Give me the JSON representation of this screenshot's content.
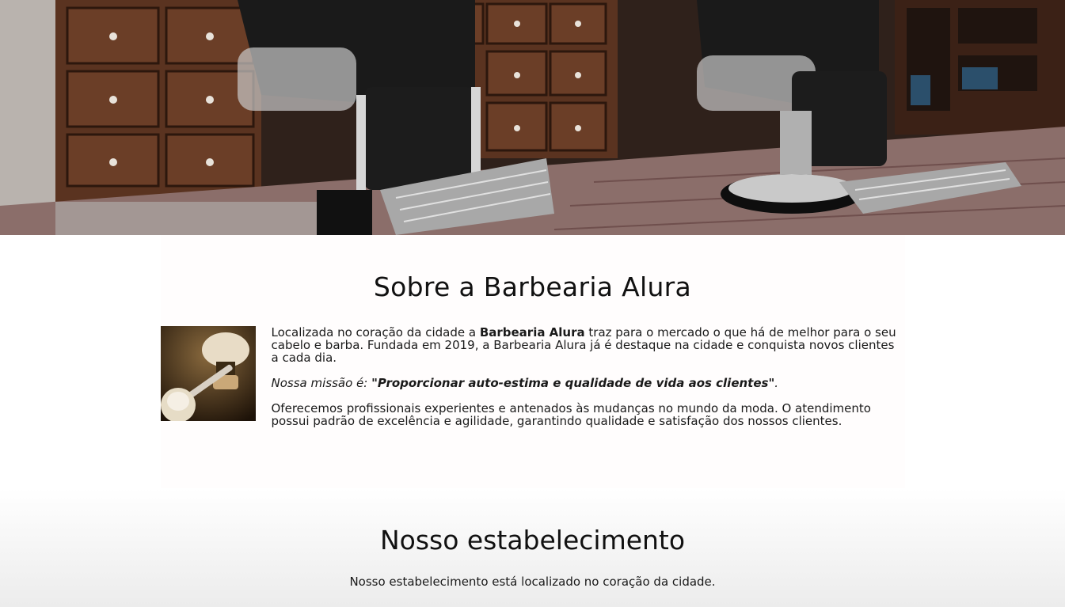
{
  "hero": {
    "image_name": "barbershop-interior-photo",
    "palette": {
      "wood": "#5a3320",
      "wood_dark": "#3b2116",
      "chrome": "#c9c9c9",
      "leather": "#1a1a1a",
      "floor": "#8b6e6a"
    }
  },
  "about": {
    "title": "Sobre a Barbearia Alura",
    "image_name": "razor-and-shaving-brush-photo",
    "p1_before": "Localizada no coração da cidade a ",
    "p1_bold": "Barbearia Alura",
    "p1_after": " traz para o mercado o que há de melhor para o seu cabelo e barba. Fundada em 2019, a Barbearia Alura já é destaque na cidade e conquista novos clientes a cada dia.",
    "mission_label": "Nossa missão é: ",
    "mission_quote": "\"Proporcionar auto-estima e qualidade de vida aos clientes\"",
    "mission_end": ".",
    "p3": "Oferecemos profissionais experientes e antenados às mudanças no mundo da moda. O atendimento possui padrão de excelência e agilidade, garantindo qualidade e satisfação dos nossos clientes."
  },
  "establishment": {
    "title": "Nosso estabelecimento",
    "text": "Nosso estabelecimento está localizado no coração da cidade."
  }
}
